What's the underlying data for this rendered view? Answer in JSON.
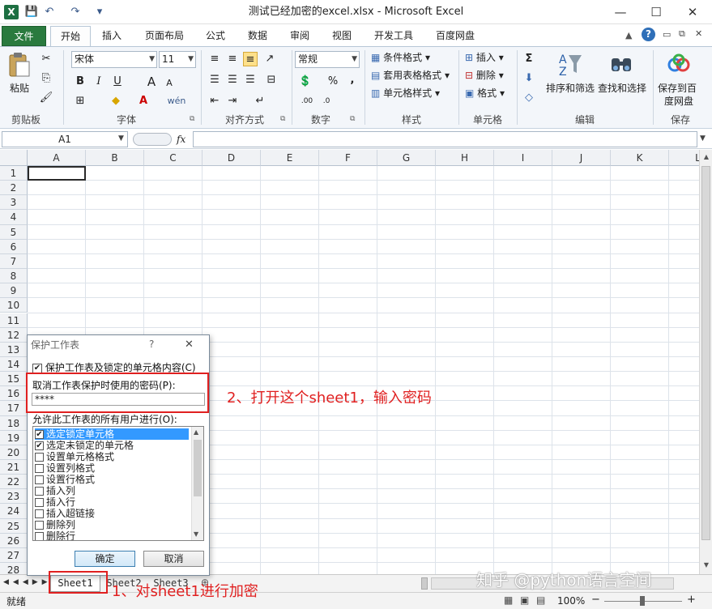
{
  "window": {
    "title": "测试已经加密的excel.xlsx - Microsoft Excel",
    "logo": "X",
    "minimize": "—",
    "maximize": "☐",
    "close": "✕"
  },
  "quick_access": {
    "save": "💾",
    "undo": "↶",
    "redo": "↷",
    "customize": "▾"
  },
  "tabs": [
    {
      "label": "文件"
    },
    {
      "label": "开始"
    },
    {
      "label": "插入"
    },
    {
      "label": "页面布局"
    },
    {
      "label": "公式"
    },
    {
      "label": "数据"
    },
    {
      "label": "审阅"
    },
    {
      "label": "视图"
    },
    {
      "label": "开发工具"
    },
    {
      "label": "百度网盘"
    }
  ],
  "ribbon": {
    "clipboard": {
      "label": "剪贴板",
      "paste": "粘贴"
    },
    "font": {
      "label": "字体",
      "name": "宋体",
      "size": "11",
      "bold": "B",
      "italic": "I",
      "underline": "U",
      "grow": "A",
      "shrink": "A",
      "wen": "wén"
    },
    "alignment": {
      "label": "对齐方式"
    },
    "number": {
      "label": "数字",
      "format": "常规",
      "percent": "%",
      "comma": ","
    },
    "styles": {
      "label": "样式",
      "cond": "条件格式",
      "table": "套用表格格式",
      "cell": "单元格样式"
    },
    "cells": {
      "label": "单元格",
      "insert": "插入",
      "delete": "删除",
      "format": "格式"
    },
    "editing": {
      "label": "编辑",
      "sigma": "Σ",
      "sort": "排序和筛选",
      "find": "查找和选择"
    },
    "save": {
      "label": "保存",
      "baidu_line1": "保存到百",
      "baidu_line2": "度网盘"
    }
  },
  "formula_bar": {
    "cell": "A1",
    "fx": "fx",
    "value": ""
  },
  "columns": [
    "A",
    "B",
    "C",
    "D",
    "E",
    "F",
    "G",
    "H",
    "I",
    "J",
    "K",
    "L"
  ],
  "rows": [
    "1",
    "2",
    "3",
    "4",
    "5",
    "6",
    "7",
    "8",
    "9",
    "10",
    "11",
    "12",
    "13",
    "14",
    "15",
    "16",
    "17",
    "18",
    "19",
    "20",
    "21",
    "22",
    "23",
    "24",
    "25",
    "26",
    "27",
    "28"
  ],
  "dialog": {
    "title": "保护工作表",
    "help": "?",
    "close": "✕",
    "protect_label": "保护工作表及锁定的单元格内容(C)",
    "password_label": "取消工作表保护时使用的密码(P):",
    "password_value": "****",
    "allow_label": "允许此工作表的所有用户进行(O):",
    "permissions": [
      {
        "label": "选定锁定单元格",
        "checked": true
      },
      {
        "label": "选定未锁定的单元格",
        "checked": true
      },
      {
        "label": "设置单元格格式",
        "checked": false
      },
      {
        "label": "设置列格式",
        "checked": false
      },
      {
        "label": "设置行格式",
        "checked": false
      },
      {
        "label": "插入列",
        "checked": false
      },
      {
        "label": "插入行",
        "checked": false
      },
      {
        "label": "插入超链接",
        "checked": false
      },
      {
        "label": "删除列",
        "checked": false
      },
      {
        "label": "删除行",
        "checked": false
      }
    ],
    "ok": "确定",
    "cancel": "取消"
  },
  "sheets": [
    {
      "label": "Sheet1"
    },
    {
      "label": "Sheet2"
    },
    {
      "label": "Sheet3"
    }
  ],
  "status": {
    "ready": "就绪",
    "zoom": "100%",
    "minus": "−",
    "plus": "+"
  },
  "annotations": {
    "step1": "1、对sheet1进行加密",
    "step2": "2、打开这个sheet1，输入密码",
    "watermark": "知乎 @python语言空间"
  },
  "colors": {
    "file_tab": "#2a7a3e",
    "annotation": "#e02020",
    "selection": "#3399ff"
  }
}
